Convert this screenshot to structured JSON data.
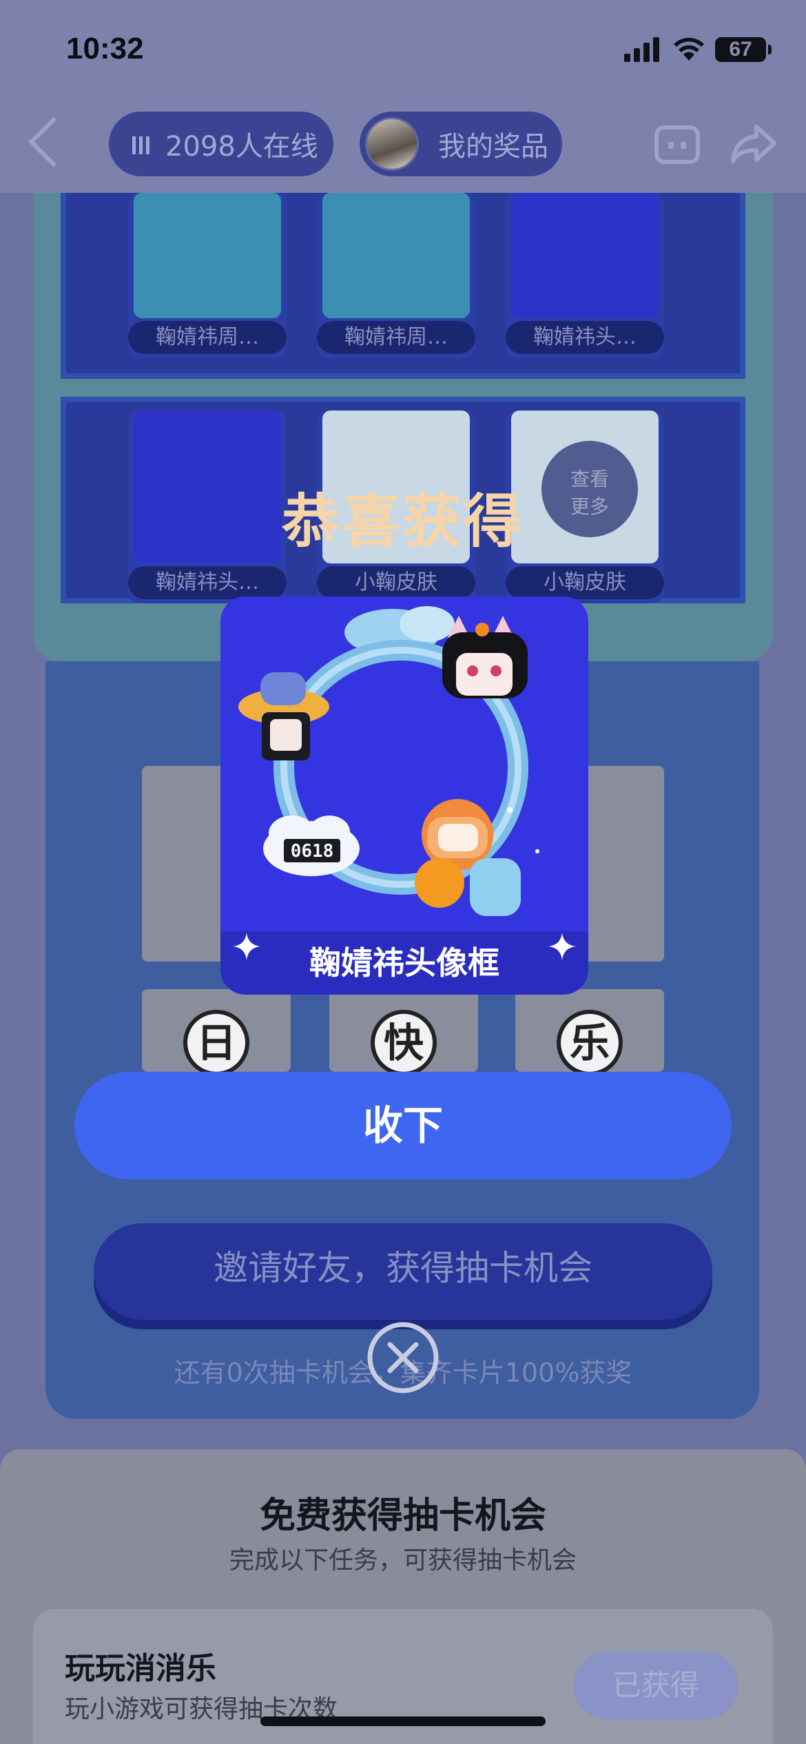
{
  "status_bar": {
    "time": "10:32",
    "battery": "67"
  },
  "header": {
    "online_count": "2098人在线",
    "my_prizes": "我的奖品"
  },
  "shelf_cards": [
    {
      "label": "鞠婧祎周…"
    },
    {
      "label": "鞠婧祎周…"
    },
    {
      "label": "鞠婧祎头…"
    },
    {
      "label": "鞠婧祎头…"
    },
    {
      "label": "小鞠皮肤"
    },
    {
      "label": "小鞠皮肤"
    }
  ],
  "view_more": {
    "line1": "查看",
    "line2": "更多"
  },
  "letter_tiles": [
    "日",
    "快",
    "乐"
  ],
  "invite_button": "邀请好友，获得抽卡机会",
  "remaining_text": "还有0次抽卡机会，集齐卡片100%获奖",
  "modal": {
    "title": "恭喜获得",
    "prize_name": "鞠婧祎头像框",
    "prize_badge": "0618",
    "accept_button": "收下"
  },
  "bottom_sheet": {
    "title": "免费获得抽卡机会",
    "subtitle": "完成以下任务，可获得抽卡机会",
    "task": {
      "name": "玩玩消消乐",
      "desc": "玩小游戏可获得抽卡次数",
      "button": "已获得"
    }
  },
  "colors": {
    "accent": "#3e66f0",
    "congrats_text": "#f7d5a8",
    "prize_card_bg": "#3435e0"
  },
  "icons": [
    "back-icon",
    "signal-icon",
    "wifi-icon",
    "battery-icon",
    "bars-icon",
    "robot-icon",
    "share-icon",
    "sparkle-icon",
    "close-icon"
  ]
}
